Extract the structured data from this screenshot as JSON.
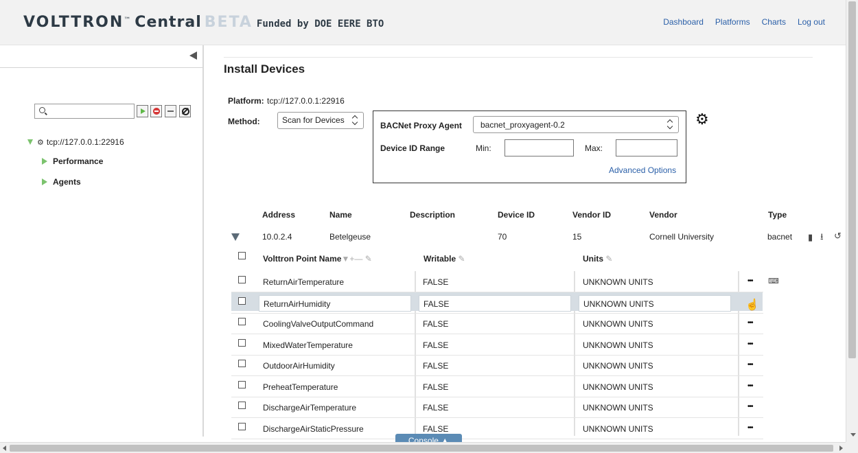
{
  "header": {
    "brand_main": "VOLTTRON",
    "brand_tm": "™",
    "brand_central": "Central",
    "brand_beta": "BETA",
    "brand_funded": "Funded by DOE EERE BTO",
    "nav": [
      "Dashboard",
      "Platforms",
      "Charts",
      "Log out"
    ]
  },
  "sidebar": {
    "search_value": "",
    "platform": "tcp://127.0.0.1:22916",
    "children": [
      "Performance",
      "Agents"
    ]
  },
  "main": {
    "title": "Install Devices",
    "platform_label": "Platform:",
    "platform_value": "tcp://127.0.0.1:22916",
    "method_label": "Method:",
    "method_value": "Scan for Devices",
    "proxy_label": "BACNet Proxy Agent",
    "proxy_value": "bacnet_proxyagent-0.2",
    "range_label": "Device ID Range",
    "min_label": "Min:",
    "max_label": "Max:",
    "min_value": "",
    "max_value": "",
    "advanced": "Advanced Options"
  },
  "device_table": {
    "headers": [
      "Address",
      "Name",
      "Description",
      "Device ID",
      "Vendor ID",
      "Vendor",
      "Type"
    ],
    "device": {
      "address": "10.0.2.4",
      "name": "Betelgeuse",
      "description": "",
      "device_id": "70",
      "vendor_id": "15",
      "vendor": "Cornell University",
      "type": "bacnet"
    }
  },
  "points_table": {
    "headers": {
      "point_name": "Volttron Point Name",
      "writable": "Writable",
      "units": "Units"
    },
    "rows": [
      {
        "name": "ReturnAirTemperature",
        "writable": "FALSE",
        "units": "UNKNOWN UNITS"
      },
      {
        "name": "ReturnAirHumidity",
        "writable": "FALSE",
        "units": "UNKNOWN UNITS"
      },
      {
        "name": "CoolingValveOutputCommand",
        "writable": "FALSE",
        "units": "UNKNOWN UNITS"
      },
      {
        "name": "MixedWaterTemperature",
        "writable": "FALSE",
        "units": "UNKNOWN UNITS"
      },
      {
        "name": "OutdoorAirHumidity",
        "writable": "FALSE",
        "units": "UNKNOWN UNITS"
      },
      {
        "name": "PreheatTemperature",
        "writable": "FALSE",
        "units": "UNKNOWN UNITS"
      },
      {
        "name": "DischargeAirTemperature",
        "writable": "FALSE",
        "units": "UNKNOWN UNITS"
      },
      {
        "name": "DischargeAirStaticPressure",
        "writable": "FALSE",
        "units": "UNKNOWN UNITS"
      }
    ],
    "row_dots": "•••"
  },
  "console": {
    "label": "Console ▲"
  },
  "colors": {
    "link": "#2a5fa8",
    "tree_triangle": "#7cc36e",
    "console_tab": "#5b8bb5",
    "selected_row": "#d6dde3"
  }
}
